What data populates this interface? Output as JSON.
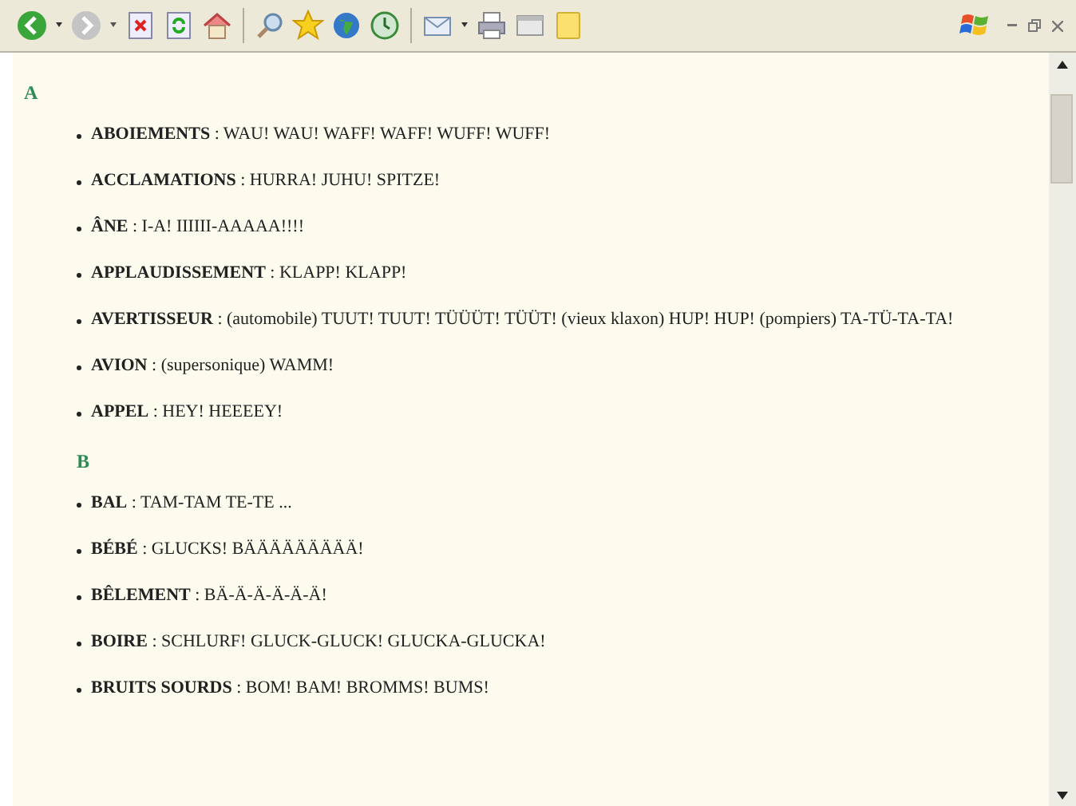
{
  "sections": [
    {
      "letter": "A",
      "entries": [
        "**ABOIEMENTS** : WAU! WAU! WAFF! WAFF! WUFF! WUFF!",
        "**ACCLAMATIONS** : HURRA! JUHU! SPITZE!",
        "**ÂNE** : I-A! IIIIII-AAAAA!!!!",
        "**APPLAUDISSEMENT** : KLAPP! KLAPP!",
        "**AVERTISSEUR** : (automobile) TUUT! TUUT! TÜÜÜT! TÜÜT! (vieux klaxon) HUP! HUP! (pompiers) TA-TÜ-TA-TA!",
        "**AVION** : (supersonique) WAMM!",
        "**APPEL** : HEY! HEEEEY!"
      ]
    },
    {
      "letter": "B",
      "entries": [
        "**BAL** : TAM-TAM TE-TE ...",
        "**BÉBÉ** : GLUCKS! BÄÄÄÄÄÄÄÄÄ!",
        "**BÊLEMENT** : BÄ-Ä-Ä-Ä-Ä-Ä!",
        "**BOIRE** : SCHLURF! GLUCK-GLUCK! GLUCKA-GLUCKA!",
        "**BRUITS SOURDS** : BOM! BAM! BROMMS! BUMS!"
      ]
    }
  ]
}
